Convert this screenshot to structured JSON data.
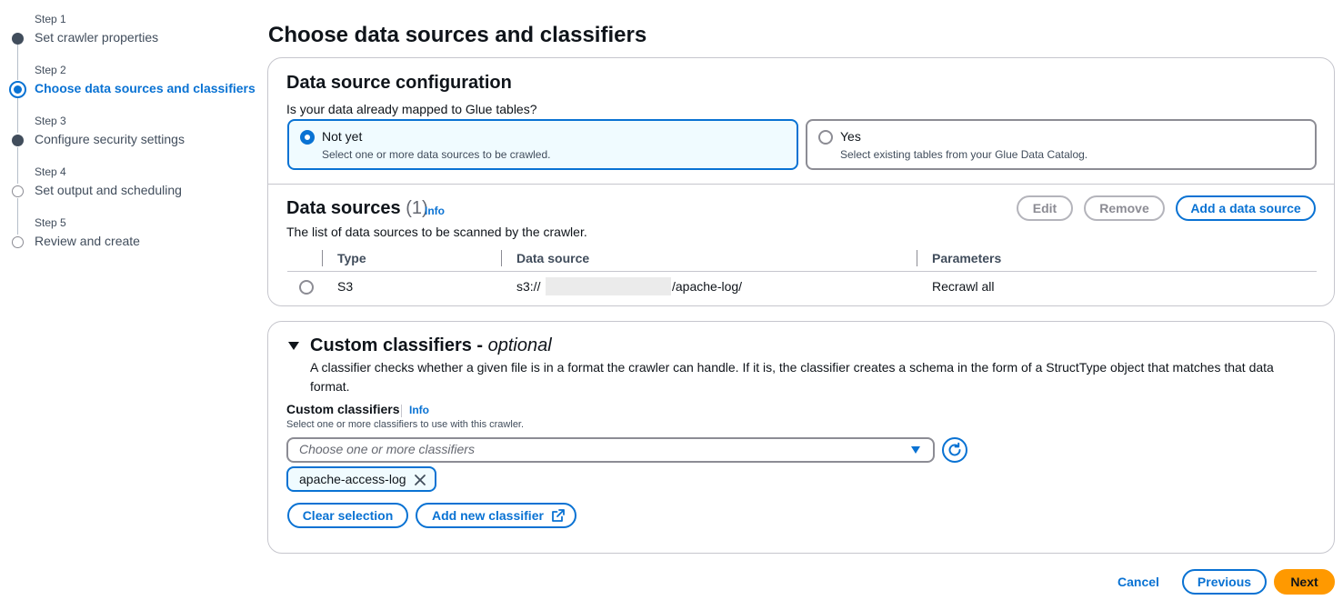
{
  "steps": [
    {
      "num": "Step 1",
      "title": "Set crawler properties",
      "state": "done"
    },
    {
      "num": "Step 2",
      "title": "Choose data sources and classifiers",
      "state": "current"
    },
    {
      "num": "Step 3",
      "title": "Configure security settings",
      "state": "done"
    },
    {
      "num": "Step 4",
      "title": "Set output and scheduling",
      "state": "pending"
    },
    {
      "num": "Step 5",
      "title": "Review and create",
      "state": "pending"
    }
  ],
  "page_title": "Choose data sources and classifiers",
  "config": {
    "heading": "Data source configuration",
    "question": "Is your data already mapped to Glue tables?",
    "options": [
      {
        "label": "Not yet",
        "desc": "Select one or more data sources to be crawled.",
        "selected": true
      },
      {
        "label": "Yes",
        "desc": "Select existing tables from your Glue Data Catalog.",
        "selected": false
      }
    ]
  },
  "sources": {
    "heading": "Data sources",
    "count": "(1)",
    "info": "Info",
    "desc": "The list of data sources to be scanned by the crawler.",
    "edit": "Edit",
    "remove": "Remove",
    "add": "Add a data source",
    "columns": [
      "Type",
      "Data source",
      "Parameters"
    ],
    "rows": [
      {
        "type": "S3",
        "source_prefix": "s3://",
        "source_suffix": "/apache-log/",
        "params": "Recrawl all"
      }
    ]
  },
  "classifiers": {
    "heading": "Custom classifiers - ",
    "heading_em": "optional",
    "desc": "A classifier checks whether a given file is in a format the crawler can handle. If it is, the classifier creates a schema in the form of a StructType object that matches that data format.",
    "field_label": "Custom classifiers",
    "info": "Info",
    "field_desc": "Select one or more classifiers to use with this crawler.",
    "placeholder": "Choose one or more classifiers",
    "tokens": [
      "apache-access-log"
    ],
    "clear": "Clear selection",
    "add_new": "Add new classifier"
  },
  "footer": {
    "cancel": "Cancel",
    "previous": "Previous",
    "next": "Next"
  },
  "colors": {
    "accent": "#0972d3",
    "primary": "#ff9900",
    "border": "#c6c6cd"
  }
}
